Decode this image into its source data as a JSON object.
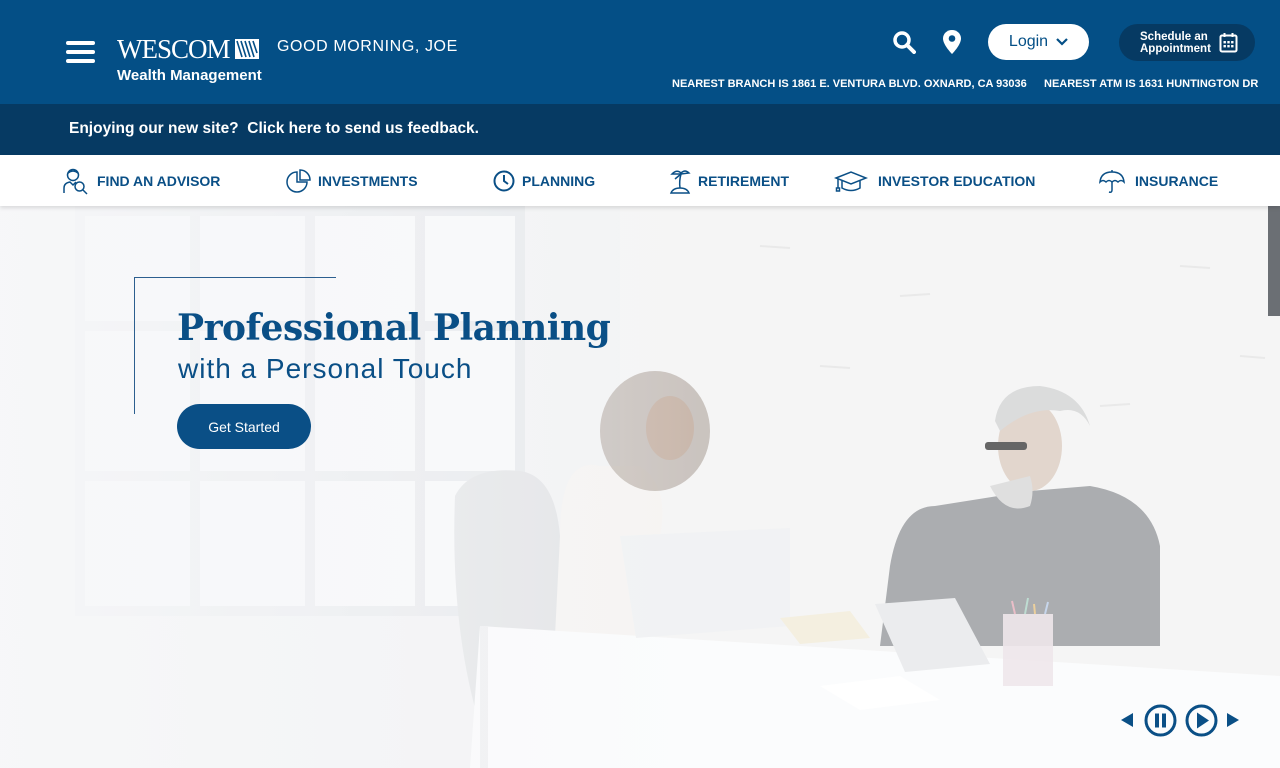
{
  "header": {
    "brand_name": "WESCOM",
    "brand_subtitle": "Wealth Management",
    "greeting": "GOOD MORNING, JOE",
    "login_label": "Login",
    "schedule_label_line1": "Schedule an",
    "schedule_label_line2": "Appointment",
    "nearest_branch": "NEAREST BRANCH IS 1861 E. VENTURA BLVD. OXNARD, CA 93036",
    "nearest_atm": "NEAREST ATM IS 1631 HUNTINGTON DR",
    "icons": [
      "menu-icon",
      "search-icon",
      "location-pin-icon",
      "chevron-down-icon",
      "calendar-icon"
    ]
  },
  "feedback_banner": {
    "text": "Enjoying our new site?  Click here to send us feedback."
  },
  "nav": {
    "items": [
      {
        "label": "FIND AN ADVISOR",
        "icon": "advisor-search-icon"
      },
      {
        "label": "INVESTMENTS",
        "icon": "pie-chart-icon"
      },
      {
        "label": "PLANNING",
        "icon": "clock-icon"
      },
      {
        "label": "RETIREMENT",
        "icon": "palm-tree-icon"
      },
      {
        "label": "INVESTOR EDUCATION",
        "icon": "graduation-cap-icon"
      },
      {
        "label": "INSURANCE",
        "icon": "umbrella-icon"
      }
    ]
  },
  "hero": {
    "title": "Professional Planning",
    "subtitle": "with a Personal Touch",
    "cta_label": "Get Started",
    "image_description": "Two colleagues talking at a white desk with laptop and tablet",
    "controls": [
      "previous-icon",
      "pause-icon",
      "play-icon",
      "next-icon"
    ]
  },
  "colors": {
    "primary": "#044f86",
    "dark_navy": "#063a63",
    "accent_text": "#0a4f86",
    "white": "#ffffff"
  }
}
